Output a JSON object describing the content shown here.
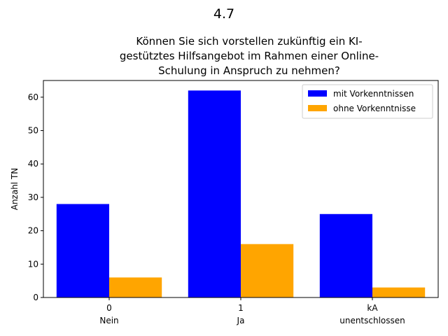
{
  "suptitle": "4.7",
  "chart_data": {
    "type": "bar",
    "title_lines": [
      "Können Sie sich vorstellen zukünftig ein KI-",
      "gestütztes Hilfsangebot im Rahmen einer Online-",
      "Schulung in Anspruch zu nehmen?"
    ],
    "xlabel": "",
    "ylabel": "Anzahl TN",
    "ylim": [
      0,
      65
    ],
    "yticks": [
      0,
      10,
      20,
      30,
      40,
      50,
      60
    ],
    "categories": [
      {
        "code": "0",
        "label": "Nein"
      },
      {
        "code": "1",
        "label": "Ja"
      },
      {
        "code": "kA",
        "label": "unentschlossen"
      }
    ],
    "series": [
      {
        "name": "mit Vorkenntnissen",
        "color": "#0000ff",
        "values": [
          28,
          62,
          25
        ]
      },
      {
        "name": "ohne Vorkenntnisse",
        "color": "#ffa500",
        "values": [
          6,
          16,
          3
        ]
      }
    ],
    "legend_position": "top-right",
    "grid": false
  }
}
